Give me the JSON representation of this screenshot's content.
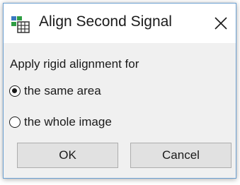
{
  "dialog": {
    "title": "Align Second Signal",
    "prompt": "Apply rigid alignment for",
    "options": [
      {
        "label": "the same area",
        "selected": true
      },
      {
        "label": "the whole image",
        "selected": false
      }
    ],
    "ok_label": "OK",
    "cancel_label": "Cancel",
    "icons": {
      "title_icon": "app-icon",
      "close_icon": "close-icon"
    },
    "colors": {
      "border": "#6a9fd1",
      "client_background": "#f0f0f0",
      "button_background": "#e1e1e1",
      "button_border": "#adadad"
    }
  }
}
